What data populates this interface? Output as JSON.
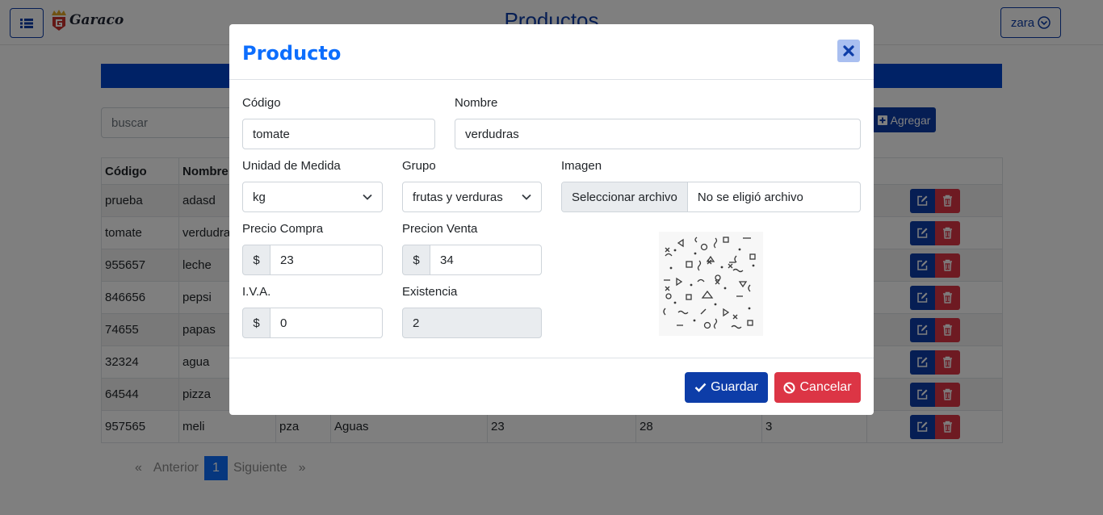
{
  "navbar": {
    "logo_text": "Garaco",
    "title": "Productos",
    "user": "zara"
  },
  "toolbar": {
    "search_placeholder": "buscar",
    "add_label": "Agregar"
  },
  "table": {
    "headers": [
      "Código",
      "Nombre"
    ],
    "rows": [
      [
        "prueba",
        "adasd",
        "",
        "",
        "",
        "",
        ""
      ],
      [
        "tomate",
        "verdudras",
        "",
        "",
        "",
        "",
        ""
      ],
      [
        "955657",
        "leche",
        "",
        "",
        "",
        "",
        ""
      ],
      [
        "846656",
        "pepsi",
        "",
        "",
        "",
        "",
        ""
      ],
      [
        "74655",
        "papas",
        "",
        "",
        "",
        "",
        ""
      ],
      [
        "32324",
        "agua",
        "",
        "",
        "",
        "",
        ""
      ],
      [
        "64544",
        "pizza",
        "",
        "",
        "",
        "",
        ""
      ],
      [
        "957565",
        "meli",
        "pza",
        "Aguas",
        "23",
        "28",
        "3"
      ]
    ]
  },
  "pagination": {
    "prev": "Anterior",
    "page": "1",
    "next": "Siguiente",
    "prev_glyph": "«",
    "next_glyph": "»"
  },
  "modal": {
    "title": "Producto",
    "codigo": {
      "label": "Código",
      "value": "tomate"
    },
    "nombre": {
      "label": "Nombre",
      "value": "verdudras"
    },
    "unidad": {
      "label": "Unidad de Medida",
      "value": "kg"
    },
    "grupo": {
      "label": "Grupo",
      "value": "frutas y verduras"
    },
    "imagen": {
      "label": "Imagen",
      "button": "Seleccionar archivo",
      "filename": "No se eligió archivo"
    },
    "precio_compra": {
      "label": "Precio Compra",
      "currency": "$",
      "value": "23"
    },
    "precio_venta": {
      "label": "Precion Venta",
      "currency": "$",
      "value": "34"
    },
    "iva": {
      "label": "I.V.A.",
      "currency": "$",
      "value": "0"
    },
    "existencia": {
      "label": "Existencia",
      "value": "2"
    },
    "save_label": "Guardar",
    "cancel_label": "Cancelar"
  },
  "colors": {
    "primary": "#0d3da8",
    "link": "#0d6efd",
    "danger": "#dc3545",
    "bar": "#0044cc"
  }
}
